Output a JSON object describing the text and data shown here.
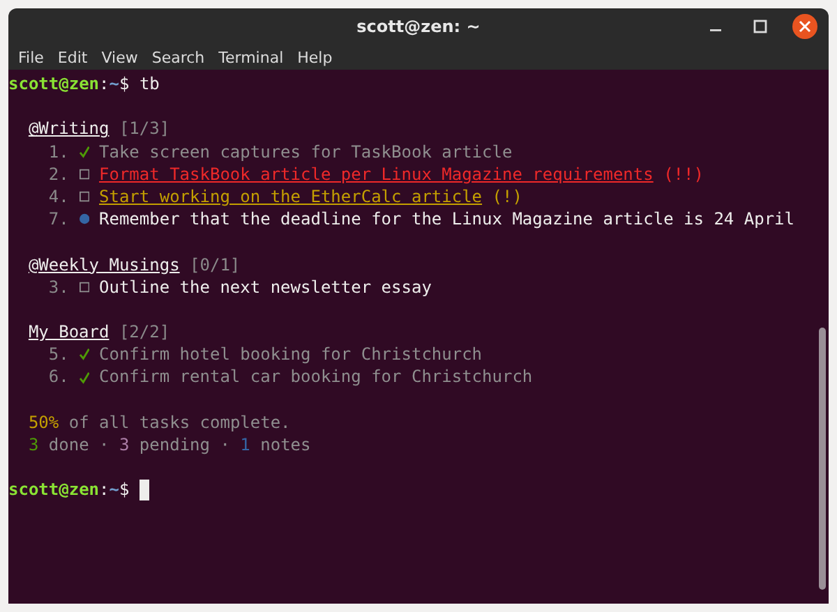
{
  "window": {
    "title": "scott@zen: ~"
  },
  "menu": [
    "File",
    "Edit",
    "View",
    "Search",
    "Terminal",
    "Help"
  ],
  "prompt": {
    "user_host": "scott@zen",
    "separator": ":",
    "path": "~",
    "symbol": "$",
    "command": "tb"
  },
  "boards": [
    {
      "name": "@Writing",
      "count": "[1/3]",
      "tasks": [
        {
          "number": "1.",
          "kind": "done",
          "text": "Take screen captures for TaskBook article",
          "color": "#8f8f8f",
          "underlined": false
        },
        {
          "number": "2.",
          "kind": "pending",
          "text": "Format TaskBook article per Linux Magazine requirements",
          "color": "#ef2929",
          "underlined": true,
          "flag": "(!!)"
        },
        {
          "number": "4.",
          "kind": "pending",
          "text": "Start working on the EtherCalc article",
          "color": "#c4a000",
          "underlined": true,
          "flag": "(!)"
        },
        {
          "number": "7.",
          "kind": "note",
          "text": "Remember that the deadline for the Linux Magazine article is 24 April",
          "color": "#eeeeec",
          "underlined": false
        }
      ]
    },
    {
      "name": "@Weekly Musings",
      "count": "[0/1]",
      "tasks": [
        {
          "number": "3.",
          "kind": "pending",
          "text": "Outline the next newsletter essay",
          "color": "#eeeeec",
          "underlined": false
        }
      ]
    },
    {
      "name": "My Board",
      "count": "[2/2]",
      "tasks": [
        {
          "number": "5.",
          "kind": "done",
          "text": "Confirm hotel booking for Christchurch",
          "color": "#8f8f8f",
          "underlined": false
        },
        {
          "number": "6.",
          "kind": "done",
          "text": "Confirm rental car booking for Christchurch",
          "color": "#8f8f8f",
          "underlined": false
        }
      ]
    }
  ],
  "summary": {
    "percent": "50%",
    "text": "of all tasks complete.",
    "done_count": "3",
    "done_label": "done ·",
    "pending_count": "3",
    "pending_label": "pending ·",
    "notes_count": "1",
    "notes_label": "notes"
  },
  "final_prompt": {
    "user_host": "scott@zen",
    "separator": ":",
    "path": "~",
    "symbol": "$"
  }
}
